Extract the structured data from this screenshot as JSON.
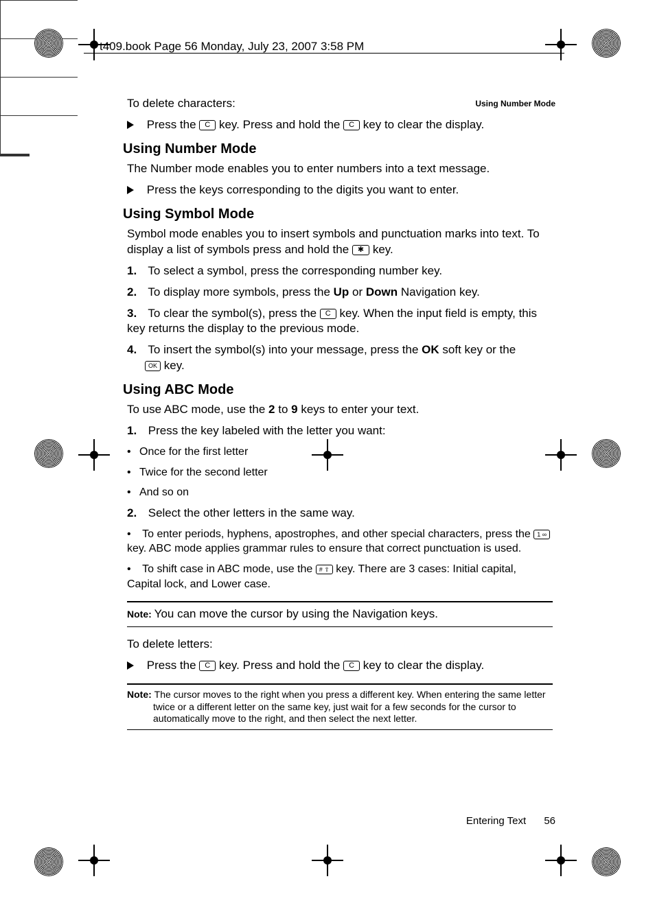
{
  "header": {
    "framemaker_line": "t409.book  Page 56  Monday, July 23, 2007  3:58 PM"
  },
  "running_head": "Using Number Mode",
  "body": {
    "delete_chars_intro": "To delete characters:",
    "delete_chars_line_a": "Press the ",
    "delete_chars_line_b": " key. Press and hold the ",
    "delete_chars_line_c": " key to clear the display.",
    "h_number": "Using Number Mode",
    "number_para": "The Number mode enables you to enter numbers into a text message.",
    "number_bullet": "Press the keys corresponding to the digits you want to enter.",
    "h_symbol": "Using Symbol Mode",
    "symbol_para_a": "Symbol mode enables you to insert symbols and punctuation marks into text. To display a list of symbols press and hold the ",
    "symbol_para_b": " key.",
    "symbol_steps": {
      "s1": "To select a symbol, press the corresponding number key.",
      "s2_a": "To display more symbols, press the ",
      "s2_up": "Up",
      "s2_mid": " or ",
      "s2_down": "Down",
      "s2_b": " Navigation key.",
      "s3_a": "To clear the symbol(s), press the ",
      "s3_b": " key. When the input field is empty, this key returns the display to the previous mode.",
      "s4_a": "To insert the symbol(s) into your message, press the ",
      "s4_ok": "OK",
      "s4_b": " soft key or the ",
      "s4_c": " key."
    },
    "h_abc": "Using ABC Mode",
    "abc_intro_a": "To use ABC mode, use the ",
    "abc_intro_2": "2",
    "abc_intro_b": " to ",
    "abc_intro_9": "9",
    "abc_intro_c": " keys to enter your text.",
    "abc_steps": {
      "s1": "Press the key labeled with the letter you want:",
      "s1_b1": "Once for the first letter",
      "s1_b2": "Twice for the second letter",
      "s1_b3": "And so on",
      "s2": "Select the other letters in the same way.",
      "s2_b1_a": "To enter periods, hyphens, apostrophes, and other special characters, press the ",
      "s2_b1_b": " key. ABC mode applies grammar rules to ensure that correct punctuation is used.",
      "s2_b2_a": "To shift case in ABC mode, use the ",
      "s2_b2_b": " key. There are 3 cases: Initial capital, Capital lock, and Lower case."
    },
    "note1": "You can move the cursor by using the Navigation keys.",
    "delete_letters_intro": "To delete letters:",
    "delete_letters_a": "Press the ",
    "delete_letters_b": " key. Press and hold the ",
    "delete_letters_c": " key to clear the display.",
    "note2": "The cursor moves to the right when you press a different key. When entering the same letter twice or a different letter on the same key, just wait for a few seconds for the cursor to automatically move to the right, and then select the next letter."
  },
  "keys": {
    "c": "C",
    "star": "✱",
    "ok": "OK",
    "one": "1 ∞",
    "hash": "# ⇧"
  },
  "labels": {
    "note": "Note: "
  },
  "footer": {
    "section": "Entering Text",
    "page": "56"
  }
}
